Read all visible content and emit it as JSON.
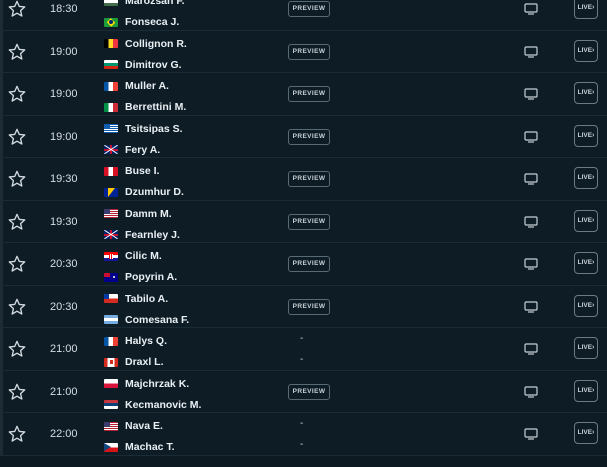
{
  "matches": [
    {
      "time": "18:30",
      "p1": {
        "name": "Marozsan F.",
        "flag": "hungary"
      },
      "p2": {
        "name": "Fonseca J.",
        "flag": "brazil"
      },
      "action": "PREVIEW"
    },
    {
      "time": "19:00",
      "p1": {
        "name": "Collignon R.",
        "flag": "belgium"
      },
      "p2": {
        "name": "Dimitrov G.",
        "flag": "bulgaria"
      },
      "action": "PREVIEW"
    },
    {
      "time": "19:00",
      "p1": {
        "name": "Muller A.",
        "flag": "france"
      },
      "p2": {
        "name": "Berrettini M.",
        "flag": "italy"
      },
      "action": "PREVIEW"
    },
    {
      "time": "19:00",
      "p1": {
        "name": "Tsitsipas S.",
        "flag": "greece"
      },
      "p2": {
        "name": "Fery A.",
        "flag": "uk"
      },
      "action": "PREVIEW"
    },
    {
      "time": "19:30",
      "p1": {
        "name": "Buse I.",
        "flag": "peru"
      },
      "p2": {
        "name": "Dzumhur D.",
        "flag": "bosnia"
      },
      "action": "PREVIEW"
    },
    {
      "time": "19:30",
      "p1": {
        "name": "Damm M.",
        "flag": "usa"
      },
      "p2": {
        "name": "Fearnley J.",
        "flag": "uk"
      },
      "action": "PREVIEW"
    },
    {
      "time": "20:30",
      "p1": {
        "name": "Cilic M.",
        "flag": "croatia"
      },
      "p2": {
        "name": "Popyrin A.",
        "flag": "australia"
      },
      "action": "PREVIEW"
    },
    {
      "time": "20:30",
      "p1": {
        "name": "Tabilo A.",
        "flag": "chile"
      },
      "p2": {
        "name": "Comesana F.",
        "flag": "argentina"
      },
      "action": "PREVIEW"
    },
    {
      "time": "21:00",
      "p1": {
        "name": "Halys Q.",
        "flag": "france"
      },
      "p2": {
        "name": "Draxl L.",
        "flag": "canada"
      },
      "action": "-"
    },
    {
      "time": "21:00",
      "p1": {
        "name": "Majchrzak K.",
        "flag": "poland"
      },
      "p2": {
        "name": "Kecmanovic M.",
        "flag": "serbia"
      },
      "action": "PREVIEW"
    },
    {
      "time": "22:00",
      "p1": {
        "name": "Nava E.",
        "flag": "usa"
      },
      "p2": {
        "name": "Machac T.",
        "flag": "czech"
      },
      "action": "-"
    }
  ],
  "live_label": "LIVE",
  "icons": {
    "favorite": "star-outline-icon",
    "tv": "tv-icon",
    "live": "live-arrow-icon"
  },
  "colors": {
    "background": "#0d1a22",
    "row": "#0e1c25",
    "border": "#1a2b36",
    "text": "#e9f0f4"
  }
}
